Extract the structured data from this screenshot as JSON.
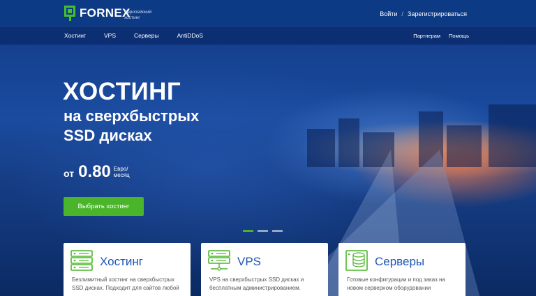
{
  "header": {
    "logo_text": "FORNEX",
    "tagline": "Европейский хостинг",
    "login": "Войти",
    "separator": "/",
    "register": "Зарегистрироваться"
  },
  "nav": {
    "items": [
      {
        "label": "Хостинг"
      },
      {
        "label": "VPS"
      },
      {
        "label": "Серверы"
      },
      {
        "label": "AntiDDoS"
      }
    ],
    "partners": "Партнерам",
    "help": "Помощь"
  },
  "hero": {
    "title": "ХОСТИНГ",
    "subtitle": "на сверхбыстрых SSD дисках",
    "price_prefix": "от",
    "price_value": "0.80",
    "price_unit": "Евро/ месяц",
    "cta": "Выбрать хостинг",
    "slides_total": 3,
    "active_slide": 1
  },
  "cards": [
    {
      "title": "Хостинг",
      "desc": "Безлимитный хостинг на сверхбыстрых SSD дисках. Подходит для сайтов любой",
      "icon": "server-rack-icon"
    },
    {
      "title": "VPS",
      "desc": "VPS на сверхбыстрых SSD дисках и бесплатным администрированием.",
      "icon": "vps-server-icon"
    },
    {
      "title": "Серверы",
      "desc": "Готовые конфигурации и под заказ на новом серверном оборудовании",
      "icon": "database-icon"
    }
  ],
  "colors": {
    "accent_green": "#4ab52a",
    "topbar": "#0d3a85",
    "card_title": "#1e56b6"
  }
}
